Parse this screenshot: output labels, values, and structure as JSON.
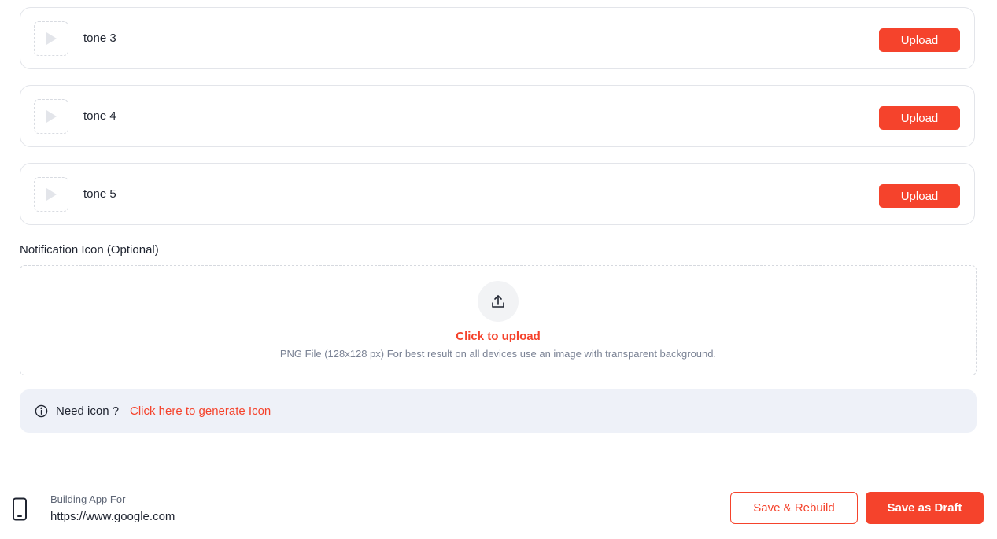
{
  "tones": [
    {
      "name": "tone 3",
      "upload_label": "Upload",
      "play_icon": "play-icon"
    },
    {
      "name": "tone 4",
      "upload_label": "Upload",
      "play_icon": "play-icon"
    },
    {
      "name": "tone 5",
      "upload_label": "Upload",
      "play_icon": "play-icon"
    }
  ],
  "notification_icon": {
    "label": "Notification Icon (Optional)",
    "upload_icon": "upload-icon",
    "click_to_upload": "Click to upload",
    "hint": "PNG File (128x128 px) For best result on all devices use an image with transparent background."
  },
  "need_icon": {
    "icon": "info-icon",
    "text": "Need icon ?",
    "link": "Click here to generate Icon"
  },
  "footer": {
    "device_icon": "phone-icon",
    "label": "Building App For",
    "url": "https://www.google.com",
    "save_rebuild": "Save & Rebuild",
    "save_draft": "Save as Draft"
  },
  "colors": {
    "accent": "#f5432c",
    "info_bg": "#eef1f8",
    "border": "#e3e5ea"
  }
}
